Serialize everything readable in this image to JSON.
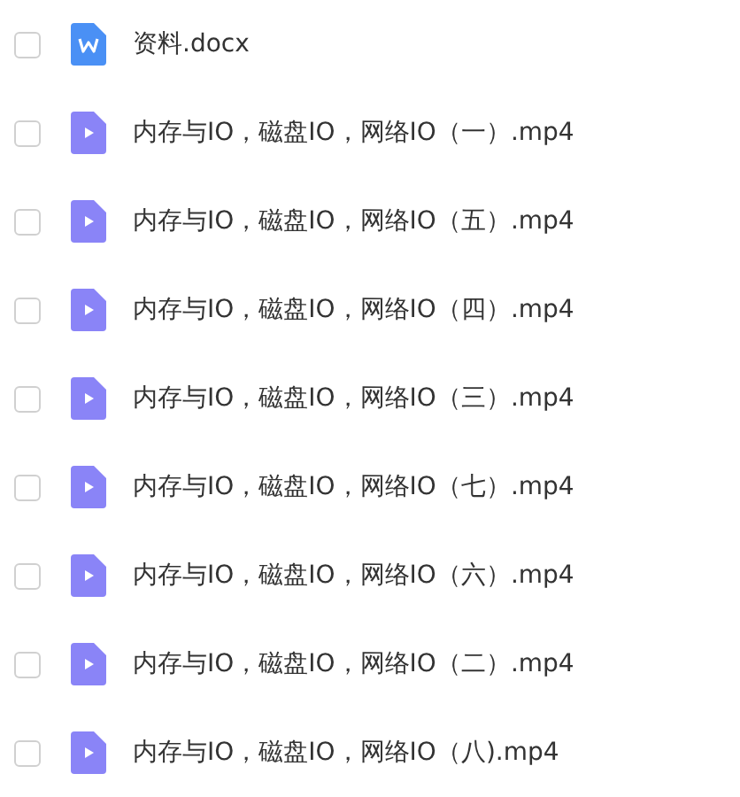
{
  "files": [
    {
      "name": "资料.docx",
      "kind": "doc",
      "checked": false
    },
    {
      "name": "内存与IO，磁盘IO，网络IO（一）.mp4",
      "kind": "video",
      "checked": false
    },
    {
      "name": "内存与IO，磁盘IO，网络IO（五）.mp4",
      "kind": "video",
      "checked": false
    },
    {
      "name": "内存与IO，磁盘IO，网络IO（四）.mp4",
      "kind": "video",
      "checked": false
    },
    {
      "name": "内存与IO，磁盘IO，网络IO（三）.mp4",
      "kind": "video",
      "checked": false
    },
    {
      "name": "内存与IO，磁盘IO，网络IO（七）.mp4",
      "kind": "video",
      "checked": false
    },
    {
      "name": "内存与IO，磁盘IO，网络IO（六）.mp4",
      "kind": "video",
      "checked": false
    },
    {
      "name": "内存与IO，磁盘IO，网络IO（二）.mp4",
      "kind": "video",
      "checked": false
    },
    {
      "name": "内存与IO，磁盘IO，网络IO（八).mp4",
      "kind": "video",
      "checked": false
    }
  ]
}
